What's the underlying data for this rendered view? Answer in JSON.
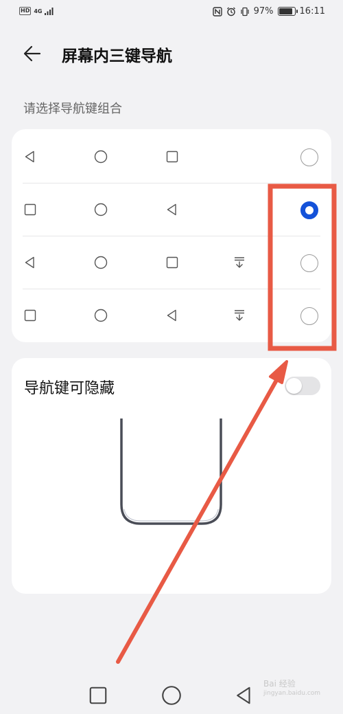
{
  "status_bar": {
    "hd": "HD",
    "network": "4G",
    "battery_percent": "97%",
    "battery_level": 0.97,
    "time": "16:11"
  },
  "header": {
    "title": "屏幕内三键导航",
    "back_icon": "arrow-left-icon"
  },
  "section_label": "请选择导航键组合",
  "nav_options": [
    {
      "icons": [
        "back-triangle-icon",
        "home-circle-icon",
        "recents-square-icon"
      ],
      "selected": false
    },
    {
      "icons": [
        "recents-square-icon",
        "home-circle-icon",
        "back-triangle-icon"
      ],
      "selected": true
    },
    {
      "icons": [
        "back-triangle-icon",
        "home-circle-icon",
        "recents-square-icon",
        "notification-pull-down-icon"
      ],
      "selected": false
    },
    {
      "icons": [
        "recents-square-icon",
        "home-circle-icon",
        "back-triangle-icon",
        "notification-pull-down-icon"
      ],
      "selected": false
    }
  ],
  "hide_nav": {
    "label": "导航键可隐藏",
    "enabled": false
  },
  "system_nav": [
    "recents-square-icon",
    "home-circle-icon",
    "back-triangle-icon"
  ],
  "watermark": {
    "text": "Bai 经验",
    "sub": "jingyan.baidu.com"
  },
  "colors": {
    "accent": "#1452d9",
    "background": "#f2f2f4",
    "card": "#ffffff",
    "annotation": "#e85a45"
  }
}
